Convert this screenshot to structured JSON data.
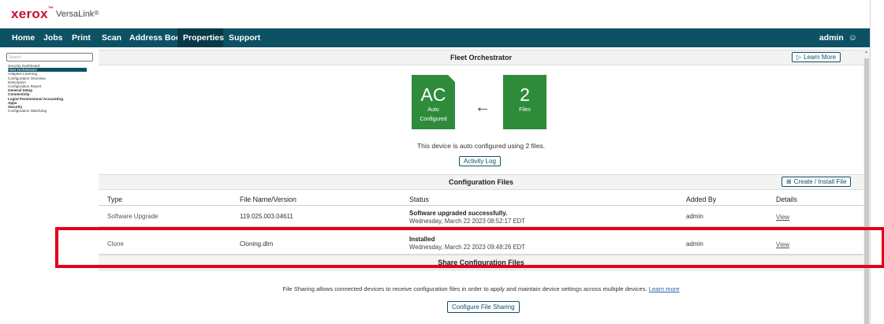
{
  "brand": {
    "logo": "xerox",
    "logo_tm": "™",
    "product": "VersaLink",
    "product_mark": "®"
  },
  "nav": {
    "items": [
      "Home",
      "Jobs",
      "Print",
      "Scan",
      "Address Book",
      "Properties",
      "Support"
    ],
    "active": "Properties",
    "user": "admin",
    "user_icon": "user-icon"
  },
  "sidebar": {
    "search_placeholder": "Search",
    "items": [
      "Security Dashboard",
      "Fleet Orchestrator",
      "Adaptive Learning",
      "Configuration Overview",
      "Description",
      "Configuration Report",
      "General Setup",
      "Connectivity",
      "Login/ Permissions/ Accounting",
      "Apps",
      "Security",
      "Configuration Watchdog"
    ],
    "selected": "Fleet Orchestrator",
    "groups": [
      "General Setup",
      "Connectivity",
      "Login/ Permissions/ Accounting",
      "Apps",
      "Security"
    ]
  },
  "fleet": {
    "title": "Fleet Orchestrator",
    "learn_more": "Learn More",
    "tile_left": {
      "big": "AC",
      "line1": "Auto",
      "line2": "Configured"
    },
    "tile_right": {
      "big": "2",
      "line1": "Files"
    },
    "arrow": "←",
    "status_text": "This device is auto configured using 2 files.",
    "activity_log": "Activity Log"
  },
  "config_files": {
    "title": "Configuration Files",
    "create_btn": "Create / Install File",
    "columns": [
      "Type",
      "File Name/Version",
      "Status",
      "Added By",
      "Details"
    ],
    "rows": [
      {
        "type": "Software Upgrade",
        "file": "119.025.003.04611",
        "status": "Software upgraded successfully.",
        "status_time": "Wednesday, March 22 2023 08:52:17 EDT",
        "added_by": "admin",
        "details": "View"
      },
      {
        "type": "Clone",
        "file": "Cloning.dlm",
        "status": "Installed",
        "status_time": "Wednesday, March 22 2023 09:48:26 EDT",
        "added_by": "admin",
        "details": "View"
      }
    ]
  },
  "share": {
    "title": "Share Configuration Files",
    "description": "File Sharing allows connected devices to receive configuration files in order to apply and maintain device settings across multiple devices.",
    "learn_more": "Learn more",
    "configure_btn": "Configure File Sharing"
  },
  "colors": {
    "nav_bg": "#0d5164",
    "tile_green": "#2e8b3a",
    "highlight_red": "#e2001a",
    "link": "#2c64b7"
  }
}
